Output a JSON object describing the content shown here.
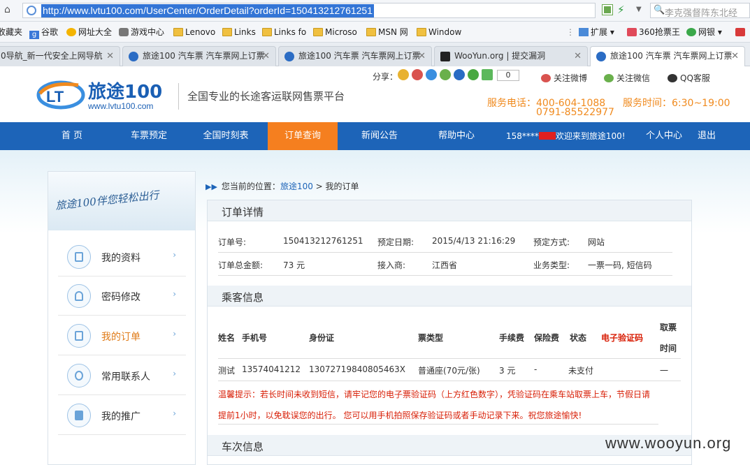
{
  "browser": {
    "url": "http://www.lvtu100.com/UserCenter/OrderDetail?orderId=150413212761251",
    "search_text": "李克强督阵东北经",
    "bookmarks": [
      "收藏夹",
      "谷歌",
      "网址大全",
      "游戏中心",
      "Lenovo",
      "Links",
      "Links fo",
      "Microso",
      "MSN 网",
      "Window",
      "扩展",
      "360抢票王",
      "网银"
    ],
    "tabs": [
      {
        "label": "0导航_新一代安全上网导航",
        "active": false
      },
      {
        "label": "旅途100 汽车票 汽车票网上订票",
        "active": false
      },
      {
        "label": "旅途100 汽车票 汽车票网上订票",
        "active": false
      },
      {
        "label": "WooYun.org | 提交漏洞",
        "active": false
      },
      {
        "label": "旅途100 汽车票 汽车票网上订票",
        "active": true
      }
    ]
  },
  "header": {
    "logo_text": "旅途100",
    "logo_url": "www.lvtu100.com",
    "slogan": "全国专业的长途客运联网售票平台",
    "share_label": "分享：",
    "share_count": "0",
    "weibo": "关注微博",
    "weixin": "关注微信",
    "qq": "QQ客服",
    "phone_label": "服务电话：400-604-1088",
    "phone2": "0791-85522977",
    "hours": "服务时间：6:30~19:00"
  },
  "nav": {
    "items": [
      "首 页",
      "车票预定",
      "全国时刻表",
      "订单查询",
      "新闻公告",
      "帮助中心"
    ],
    "active_index": 3,
    "user_prefix": "158****",
    "welcome": "欢迎来到旅途100!",
    "center": "个人中心",
    "logout": "退出"
  },
  "sidebar": {
    "banner": "旅途100伴您轻松出行",
    "items": [
      "我的资料",
      "密码修改",
      "我的订单",
      "常用联系人",
      "我的推广"
    ],
    "active_index": 2
  },
  "breadcrumb": {
    "prefix": "您当前的位置：",
    "home": "旅途100",
    "sep": " > ",
    "current": "我的订单"
  },
  "order": {
    "title": "订单详情",
    "no_label": "订单号:",
    "no": "150413212761251",
    "date_label": "预定日期:",
    "date": "2015/4/13 21:16:29",
    "way_label": "预定方式:",
    "way": "网站",
    "total_label": "订单总金额:",
    "total": "73 元",
    "provider_label": "接入商:",
    "provider": "江西省",
    "type_label": "业务类型:",
    "type": "一票一码, 短信码"
  },
  "passenger": {
    "title": "乘客信息",
    "headers": [
      "姓名",
      "手机号",
      "身份证",
      "票类型",
      "手续费",
      "保险费",
      "状态",
      "电子验证码",
      "取票",
      "时间"
    ],
    "row": [
      "测试",
      "13574041212",
      "13072719840805463X",
      "普通座(70元/张)",
      "3 元",
      "-",
      "未支付",
      "",
      "一"
    ],
    "notice1": "温馨提示：若长时间未收到短信，请牢记您的电子票验证码（上方红色数字），凭验证码在乘车站取票上车，节假日请",
    "notice2": "提前1小时，以免耽误您的出行。 您可以用手机拍照保存验证码或者手动记录下来。祝您旅途愉快!"
  },
  "trip": {
    "title": "车次信息"
  },
  "watermark": "www.wooyun.org"
}
